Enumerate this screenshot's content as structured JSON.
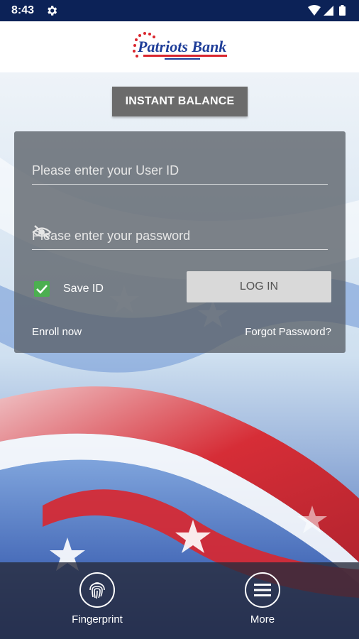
{
  "status_bar": {
    "time": "8:43"
  },
  "header": {
    "logo_text": "Patriots Bank"
  },
  "instant_balance_label": "INSTANT BALANCE",
  "login_form": {
    "userid_placeholder": "Please enter your User ID",
    "password_placeholder": "Please enter your password",
    "save_id_label": "Save ID",
    "save_id_checked": true,
    "login_label": "LOG IN",
    "enroll_label": "Enroll now",
    "forgot_label": "Forgot Password?"
  },
  "bottom_bar": {
    "fingerprint_label": "Fingerprint",
    "more_label": "More"
  },
  "colors": {
    "status_bar": "#0c2257",
    "accent_check": "#4caf50",
    "brand_blue": "#1f3e99",
    "brand_red": "#d9262e"
  }
}
